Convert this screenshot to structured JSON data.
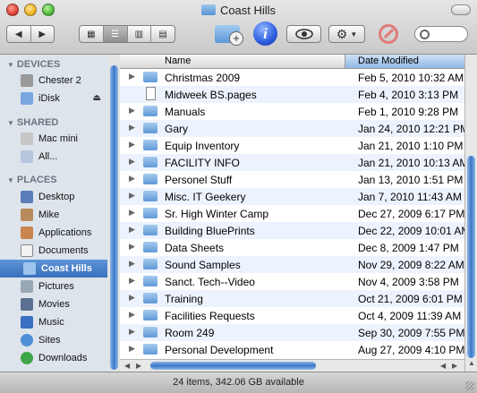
{
  "window": {
    "title": "Coast Hills",
    "folder_color": "#6fa6e0",
    "accent_color": "#3a78c9"
  },
  "toolbar": {
    "back_icon": "chevron-left-icon",
    "forward_icon": "chevron-right-icon",
    "view_modes": [
      "icon-view-icon",
      "list-view-icon",
      "column-view-icon",
      "coverflow-view-icon"
    ],
    "selected_view": "list-view-icon",
    "new_folder_icon": "new-folder-icon",
    "info_label": "i",
    "quicklook_icon": "eye-icon",
    "action_icon": "gear-icon",
    "noentry_icon": "no-entry-icon",
    "search_placeholder": ""
  },
  "sidebar": {
    "sections": [
      {
        "title": "DEVICES",
        "items": [
          {
            "label": "Chester 2",
            "icon": "hard-drive-icon"
          },
          {
            "label": "iDisk",
            "icon": "idisk-icon",
            "eject": "⏏"
          }
        ]
      },
      {
        "title": "SHARED",
        "items": [
          {
            "label": "Mac mini",
            "icon": "mac-mini-icon"
          },
          {
            "label": "All...",
            "icon": "network-icon"
          }
        ]
      },
      {
        "title": "PLACES",
        "items": [
          {
            "label": "Desktop",
            "icon": "desktop-icon"
          },
          {
            "label": "Mike",
            "icon": "home-icon"
          },
          {
            "label": "Applications",
            "icon": "applications-icon"
          },
          {
            "label": "Documents",
            "icon": "documents-icon"
          },
          {
            "label": "Coast Hills",
            "icon": "folder-icon",
            "selected": true
          },
          {
            "label": "Pictures",
            "icon": "pictures-icon"
          },
          {
            "label": "Movies",
            "icon": "movies-icon"
          },
          {
            "label": "Music",
            "icon": "music-icon"
          },
          {
            "label": "Sites",
            "icon": "sites-icon"
          },
          {
            "label": "Downloads",
            "icon": "downloads-icon"
          }
        ]
      }
    ]
  },
  "list": {
    "columns": {
      "name": "Name",
      "date": "Date Modified"
    },
    "rows": [
      {
        "name": "Christmas 2009",
        "date": "Feb 5, 2010 10:32 AM",
        "kind": "folder"
      },
      {
        "name": "Midweek BS.pages",
        "date": "Feb 4, 2010 3:13 PM",
        "kind": "document"
      },
      {
        "name": "Manuals",
        "date": "Feb 1, 2010 9:28 PM",
        "kind": "folder"
      },
      {
        "name": "Gary",
        "date": "Jan 24, 2010 12:21 PM",
        "kind": "folder"
      },
      {
        "name": "Equip Inventory",
        "date": "Jan 21, 2010 1:10 PM",
        "kind": "folder"
      },
      {
        "name": "FACILITY INFO",
        "date": "Jan 21, 2010 10:13 AM",
        "kind": "folder"
      },
      {
        "name": "Personel Stuff",
        "date": "Jan 13, 2010 1:51 PM",
        "kind": "folder"
      },
      {
        "name": "Misc. IT Geekery",
        "date": "Jan 7, 2010 11:43 AM",
        "kind": "folder"
      },
      {
        "name": "Sr. High Winter Camp",
        "date": "Dec 27, 2009 6:17 PM",
        "kind": "folder"
      },
      {
        "name": "Building BluePrints",
        "date": "Dec 22, 2009 10:01 AM",
        "kind": "folder"
      },
      {
        "name": "Data Sheets",
        "date": "Dec 8, 2009 1:47 PM",
        "kind": "folder"
      },
      {
        "name": "Sound Samples",
        "date": "Nov 29, 2009 8:22 AM",
        "kind": "folder"
      },
      {
        "name": "Sanct. Tech--Video",
        "date": "Nov 4, 2009 3:58 PM",
        "kind": "folder"
      },
      {
        "name": "Training",
        "date": "Oct 21, 2009 6:01 PM",
        "kind": "folder"
      },
      {
        "name": "Facilities Requests",
        "date": "Oct 4, 2009 11:39 AM",
        "kind": "folder"
      },
      {
        "name": "Room 249",
        "date": "Sep 30, 2009 7:55 PM",
        "kind": "folder"
      },
      {
        "name": "Personal Development",
        "date": "Aug 27, 2009 4:10 PM",
        "kind": "folder"
      }
    ]
  },
  "status": {
    "text": "24 items, 342.06 GB available"
  }
}
